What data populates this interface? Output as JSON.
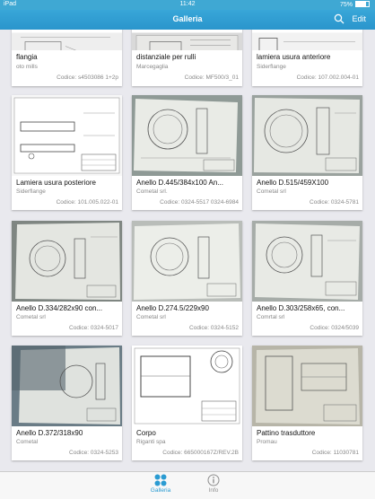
{
  "status": {
    "device": "iPad",
    "time": "11:42",
    "battery": "75%"
  },
  "nav": {
    "title": "Galleria",
    "edit_label": "Edit"
  },
  "cards": [
    {
      "title": "flangia",
      "supplier": "oto mills",
      "code_label": "Codice:",
      "code": "s4503086 1+2p"
    },
    {
      "title": "distanziale per rulli",
      "supplier": "Marcegaglia",
      "code_label": "Codice:",
      "code": "MF500/3_01"
    },
    {
      "title": "lamiera usura anteriore",
      "supplier": "Siderflange",
      "code_label": "Codice:",
      "code": "107.002.004-01"
    },
    {
      "title": "Lamiera usura posteriore",
      "supplier": "Siderflange",
      "code_label": "Codice:",
      "code": "101.005.022-01"
    },
    {
      "title": "Anello D.445/384x100 An...",
      "supplier": "Cometal srl.",
      "code_label": "Codice:",
      "code": "0324-5517 0324-6984"
    },
    {
      "title": "Anello D.515/459X100",
      "supplier": "Cometal srl",
      "code_label": "Codice:",
      "code": "0324-5781"
    },
    {
      "title": "Anello D.334/282x90 con...",
      "supplier": "Cometal srl",
      "code_label": "Codice:",
      "code": "0324-5017"
    },
    {
      "title": "Anello D.274.5/229x90",
      "supplier": "Cometal srl",
      "code_label": "Codice:",
      "code": "0324-5152"
    },
    {
      "title": "Anello D.303/258x65, con...",
      "supplier": "Comrtal srl",
      "code_label": "Codice:",
      "code": "0324/5039"
    },
    {
      "title": "Anello D.372/318x90",
      "supplier": "Cometal",
      "code_label": "Codice:",
      "code": "0324-5253"
    },
    {
      "title": "Corpo",
      "supplier": "Riganti spa",
      "code_label": "Codice:",
      "code": "665000167Z/REV.2B"
    },
    {
      "title": "Pattino trasduttore",
      "supplier": "Promau",
      "code_label": "Codice:",
      "code": "11030781"
    }
  ],
  "tabs": [
    {
      "label": "Galleria",
      "icon": "gallery-icon",
      "active": true
    },
    {
      "label": "Info",
      "icon": "info-icon",
      "active": false
    }
  ],
  "colors": {
    "accent": "#2a9bd2",
    "navbar": "#2b9bd1",
    "background": "#e9e9ee"
  }
}
